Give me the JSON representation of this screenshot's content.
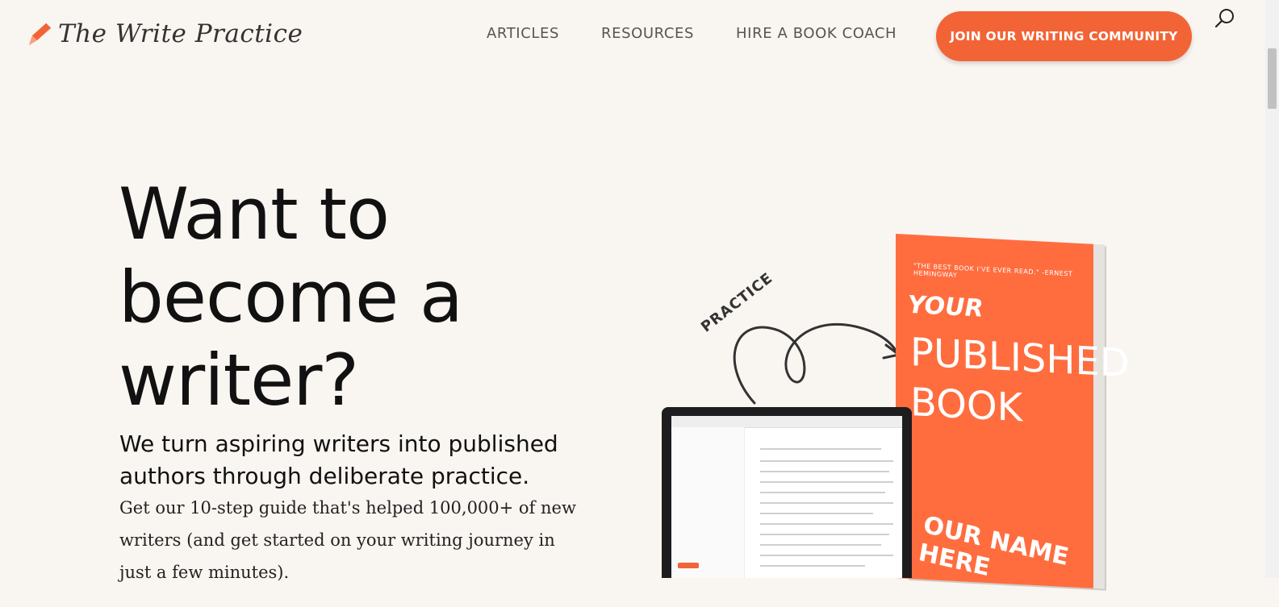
{
  "header": {
    "logo_text": "The Write Practice",
    "nav": [
      "ARTICLES",
      "RESOURCES",
      "HIRE A BOOK COACH"
    ],
    "cta_label": "JOIN OUR WRITING COMMUNITY"
  },
  "hero": {
    "title": "Want to become a writer?",
    "subtitle": "We turn aspiring writers into published authors through deliberate practice.",
    "description": "Get our 10-step guide that's helped 100,000+ of new writers (and get started on your writing journey in just a few minutes)."
  },
  "illustration": {
    "practice_word": "PRACTICE",
    "book_quote": "\"THE BEST BOOK I'VE EVER READ.\" -ERNEST HEMINGWAY",
    "book_your": "YOUR",
    "book_title": "PUBLISHED BOOK",
    "book_name": "OUR NAME HERE"
  },
  "colors": {
    "accent": "#f26436",
    "background": "#f9f5f1",
    "text": "#111111"
  },
  "icons": {
    "logo": "pencil-icon",
    "search": "search-icon"
  }
}
